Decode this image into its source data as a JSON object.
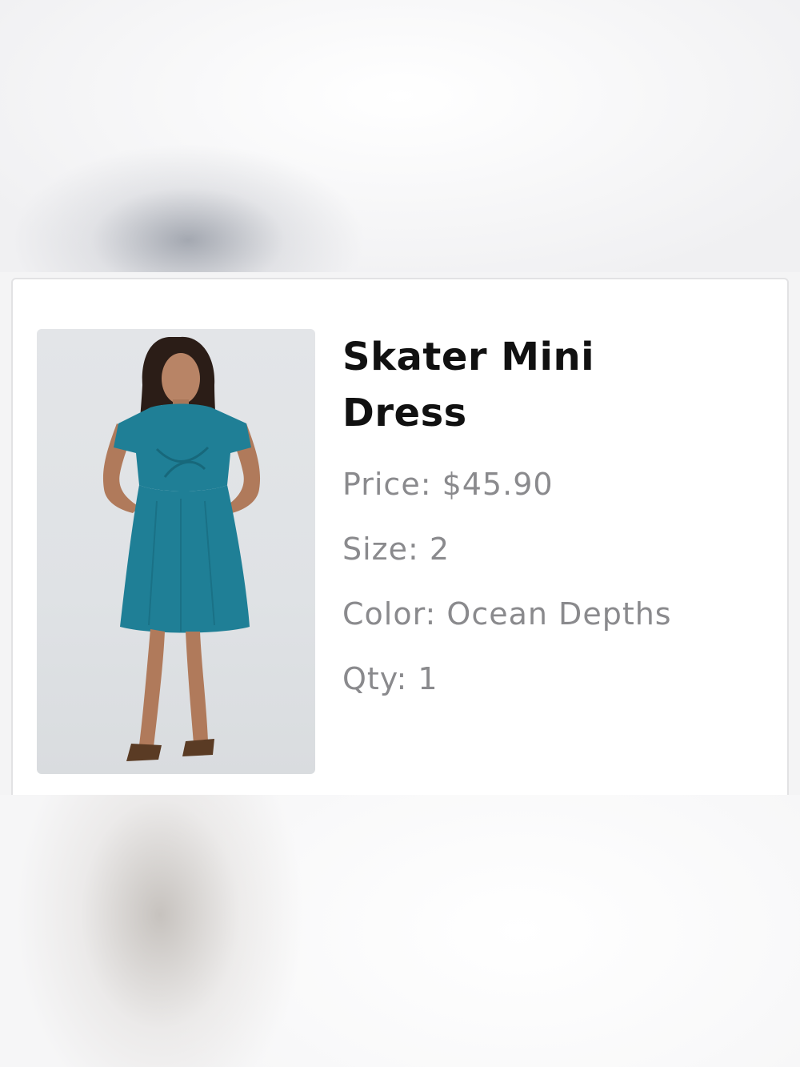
{
  "product": {
    "image_alt": "Model wearing teal skater mini dress",
    "title": "Skater Mini Dress",
    "price": "Price: $45.90",
    "size": "Size: 2",
    "color": "Color: Ocean Depths",
    "qty": "Qty: 1"
  },
  "colors": {
    "dress": "#1f7f96",
    "text_primary": "#111111",
    "text_secondary": "#8a8a8d"
  }
}
